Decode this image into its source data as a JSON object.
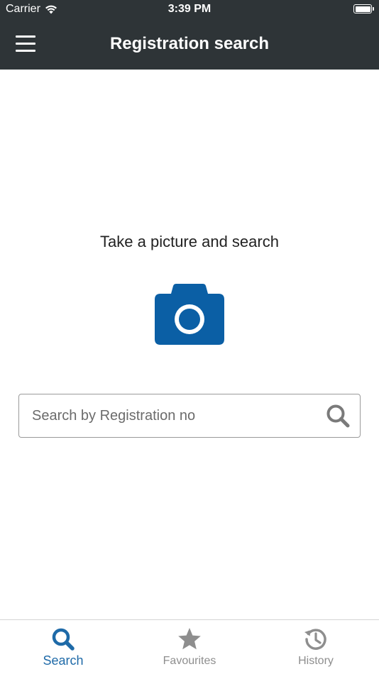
{
  "status_bar": {
    "carrier": "Carrier",
    "time": "3:39 PM"
  },
  "header": {
    "title": "Registration search"
  },
  "main": {
    "prompt": "Take a picture and search",
    "search": {
      "placeholder": "Search by Registration no",
      "value": ""
    }
  },
  "tabs": [
    {
      "label": "Search",
      "icon": "search-icon",
      "active": true
    },
    {
      "label": "Favourites",
      "icon": "star-icon",
      "active": false
    },
    {
      "label": "History",
      "icon": "history-icon",
      "active": false
    }
  ],
  "colors": {
    "header_bg": "#2e3437",
    "accent": "#1e6aa8",
    "camera": "#0b5fa5",
    "inactive": "#8e8e8e"
  }
}
